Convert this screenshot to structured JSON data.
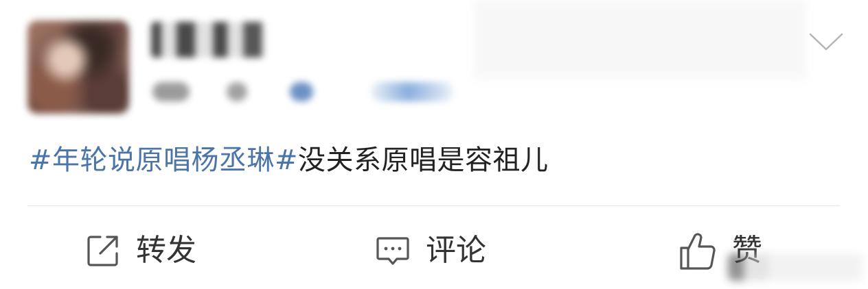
{
  "header": {
    "menu_icon": "chevron-down-icon"
  },
  "post": {
    "hashtag": "#年轮说原唱杨丞琳#",
    "text": "没关系原唱是容祖儿"
  },
  "actions": {
    "repost": {
      "icon": "share-out-icon",
      "label": "转发"
    },
    "comment": {
      "icon": "comment-bubble-icon",
      "label": "评论"
    },
    "like": {
      "icon": "thumbs-up-icon",
      "label": "赞"
    }
  },
  "colors": {
    "hashtag": "#4b74a8",
    "text": "#222222",
    "icon": "#555555",
    "divider": "#e8e8e8"
  }
}
